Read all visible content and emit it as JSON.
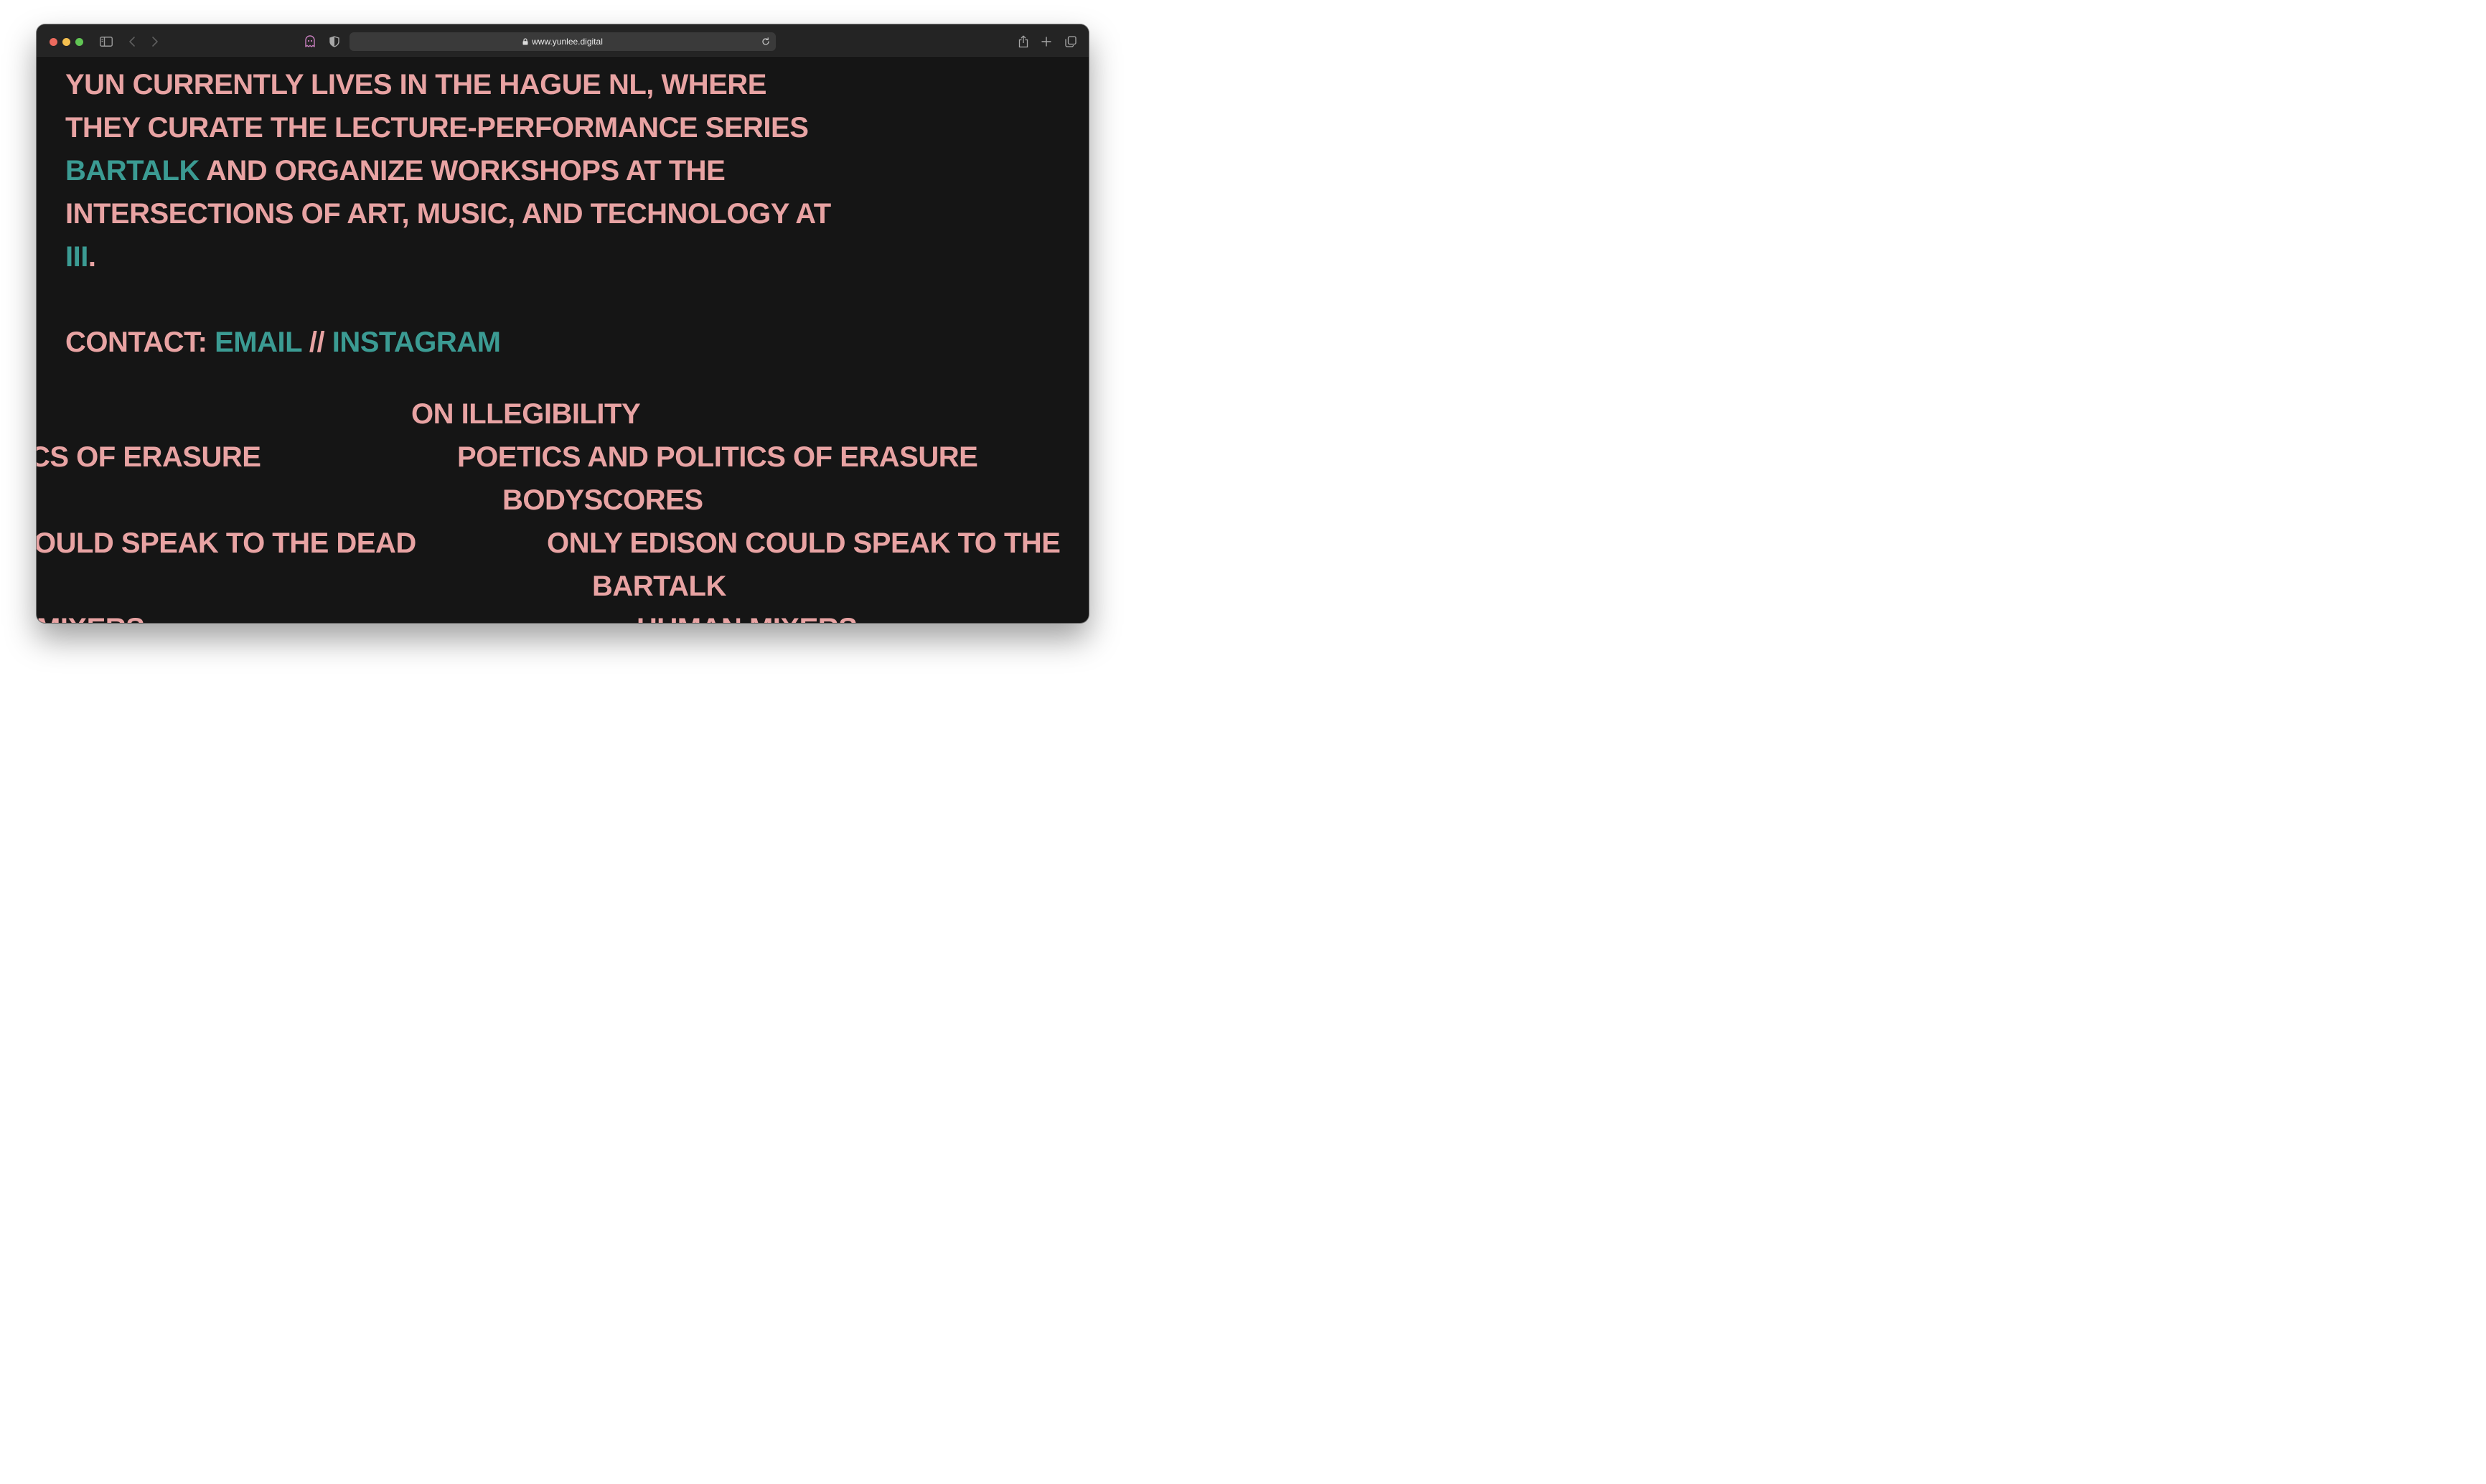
{
  "browser": {
    "url": "www.yunlee.digital",
    "icons": [
      "sidebar-icon",
      "back-icon",
      "forward-icon",
      "ghost-extension-icon",
      "privacy-shield-icon",
      "lock-icon",
      "reload-icon",
      "share-icon",
      "new-tab-icon",
      "tab-overview-icon"
    ]
  },
  "bio": {
    "line1": "YUN CURRENTLY LIVES IN THE HAGUE NL, WHERE",
    "line2": "THEY CURATE THE LECTURE-PERFORMANCE SERIES",
    "bartalk_link": "BARTALK",
    "line3_rest": " AND ORGANIZE WORKSHOPS AT THE",
    "line4": "INTERSECTIONS OF ART, MUSIC, AND TECHNOLOGY AT",
    "iii_link": "III",
    "period": "."
  },
  "contact": {
    "label": "CONTACT: ",
    "email_link": "EMAIL",
    "separator": " // ",
    "instagram_link": "INSTAGRAM"
  },
  "projects": {
    "on_illegibility": "ON ILLEGIBILITY",
    "erasure_partial": "CS OF ERASURE",
    "erasure_full": "POETICS AND POLITICS OF ERASURE",
    "bodyscores": "BODYSCORES",
    "edison_partial": "OULD SPEAK TO THE DEAD",
    "edison_full": "ONLY EDISON COULD SPEAK TO THE",
    "bartalk": "BARTALK",
    "mixers_partial": "MIXERS",
    "human_mixers": "HUMAN MIXERS"
  },
  "colors": {
    "text": "#e8a3a3",
    "link": "#3b9b93",
    "background": "#151515"
  }
}
